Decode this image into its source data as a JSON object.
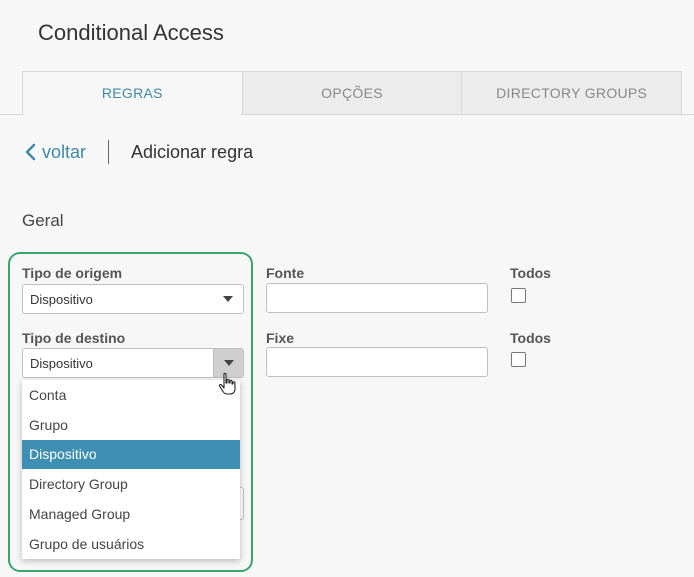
{
  "app": {
    "title": "Conditional Access"
  },
  "tabs": [
    {
      "label": "REGRAS",
      "active": true
    },
    {
      "label": "OPÇÕES",
      "active": false
    },
    {
      "label": "DIRECTORY GROUPS",
      "active": false
    }
  ],
  "breadcrumb": {
    "back_label": "voltar",
    "title": "Adicionar regra"
  },
  "section": {
    "title": "Geral"
  },
  "form": {
    "source_type": {
      "label": "Tipo de origem",
      "value": "Dispositivo"
    },
    "source": {
      "label": "Fonte",
      "value": ""
    },
    "source_all": {
      "label": "Todos",
      "checked": false
    },
    "target_type": {
      "label": "Tipo de destino",
      "value": "Dispositivo"
    },
    "target": {
      "label": "Fixe",
      "value": ""
    },
    "target_all": {
      "label": "Todos",
      "checked": false
    }
  },
  "dropdown": {
    "options": [
      "Conta",
      "Grupo",
      "Dispositivo",
      "Directory Group",
      "Managed Group",
      "Grupo de usuários"
    ],
    "selected": "Dispositivo"
  },
  "colors": {
    "accent": "#3f87a6",
    "selected_option": "#3f8fb3",
    "highlight_border": "#3aa46a"
  }
}
